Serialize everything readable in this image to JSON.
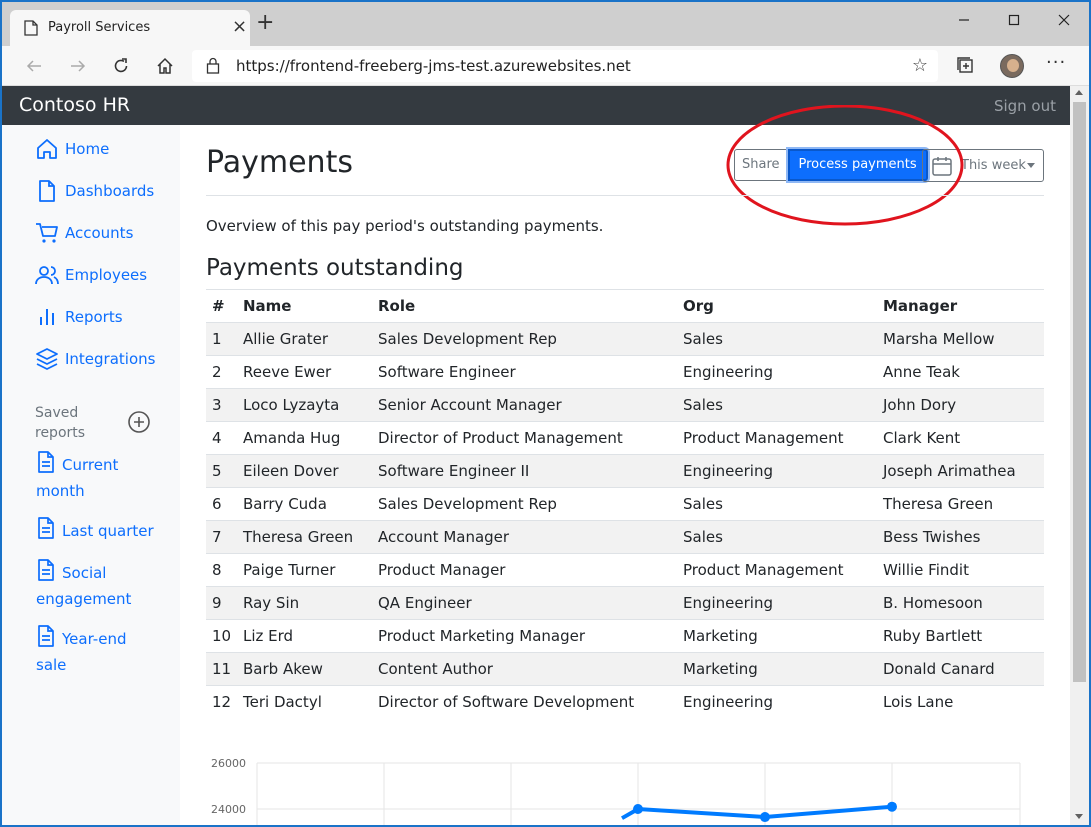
{
  "browser": {
    "tab_title": "Payroll Services",
    "url": "https://frontend-freeberg-jms-test.azurewebsites.net"
  },
  "app": {
    "brand": "Contoso HR",
    "sign_out": "Sign out"
  },
  "sidebar": {
    "items": [
      {
        "label": "Home",
        "icon": "home-icon"
      },
      {
        "label": "Dashboards",
        "icon": "file-icon"
      },
      {
        "label": "Accounts",
        "icon": "cart-icon"
      },
      {
        "label": "Employees",
        "icon": "users-icon"
      },
      {
        "label": "Reports",
        "icon": "bar-chart-icon"
      },
      {
        "label": "Integrations",
        "icon": "layers-icon"
      }
    ],
    "saved_reports_heading": "Saved reports",
    "saved_reports": [
      {
        "label": "Current month"
      },
      {
        "label": "Last quarter"
      },
      {
        "label": "Social engagement"
      },
      {
        "label": "Year-end sale"
      }
    ]
  },
  "main": {
    "title": "Payments",
    "share_label": "Share",
    "process_label": "Process payments",
    "period_label": "This week",
    "overview": "Overview of this pay period's outstanding payments.",
    "section_title": "Payments outstanding",
    "columns": [
      "#",
      "Name",
      "Role",
      "Org",
      "Manager"
    ],
    "rows": [
      [
        "1",
        "Allie Grater",
        "Sales Development Rep",
        "Sales",
        "Marsha Mellow"
      ],
      [
        "2",
        "Reeve Ewer",
        "Software Engineer",
        "Engineering",
        "Anne Teak"
      ],
      [
        "3",
        "Loco Lyzayta",
        "Senior Account Manager",
        "Sales",
        "John Dory"
      ],
      [
        "4",
        "Amanda Hug",
        "Director of Product Management",
        "Product Management",
        "Clark Kent"
      ],
      [
        "5",
        "Eileen Dover",
        "Software Engineer II",
        "Engineering",
        "Joseph Arimathea"
      ],
      [
        "6",
        "Barry Cuda",
        "Sales Development Rep",
        "Sales",
        "Theresa Green"
      ],
      [
        "7",
        "Theresa Green",
        "Account Manager",
        "Sales",
        "Bess Twishes"
      ],
      [
        "8",
        "Paige Turner",
        "Product Manager",
        "Product Management",
        "Willie Findit"
      ],
      [
        "9",
        "Ray Sin",
        "QA Engineer",
        "Engineering",
        "B. Homesoon"
      ],
      [
        "10",
        "Liz Erd",
        "Product Marketing Manager",
        "Marketing",
        "Ruby Bartlett"
      ],
      [
        "11",
        "Barb Akew",
        "Content Author",
        "Marketing",
        "Donald Canard"
      ],
      [
        "12",
        "Teri Dactyl",
        "Director of Software Development",
        "Engineering",
        "Lois Lane"
      ]
    ]
  },
  "chart_data": {
    "type": "line",
    "y_ticks": [
      "26000",
      "24000"
    ],
    "ylim": [
      23000,
      26000
    ],
    "series": [
      {
        "values": [
          23600,
          24000,
          23650,
          24100
        ],
        "points_visible": [
          false,
          true,
          true,
          true
        ]
      }
    ],
    "color": "#007bff"
  },
  "colors": {
    "accent": "#0d6efd",
    "navbar": "#343a40",
    "annotation": "#e0141e"
  }
}
